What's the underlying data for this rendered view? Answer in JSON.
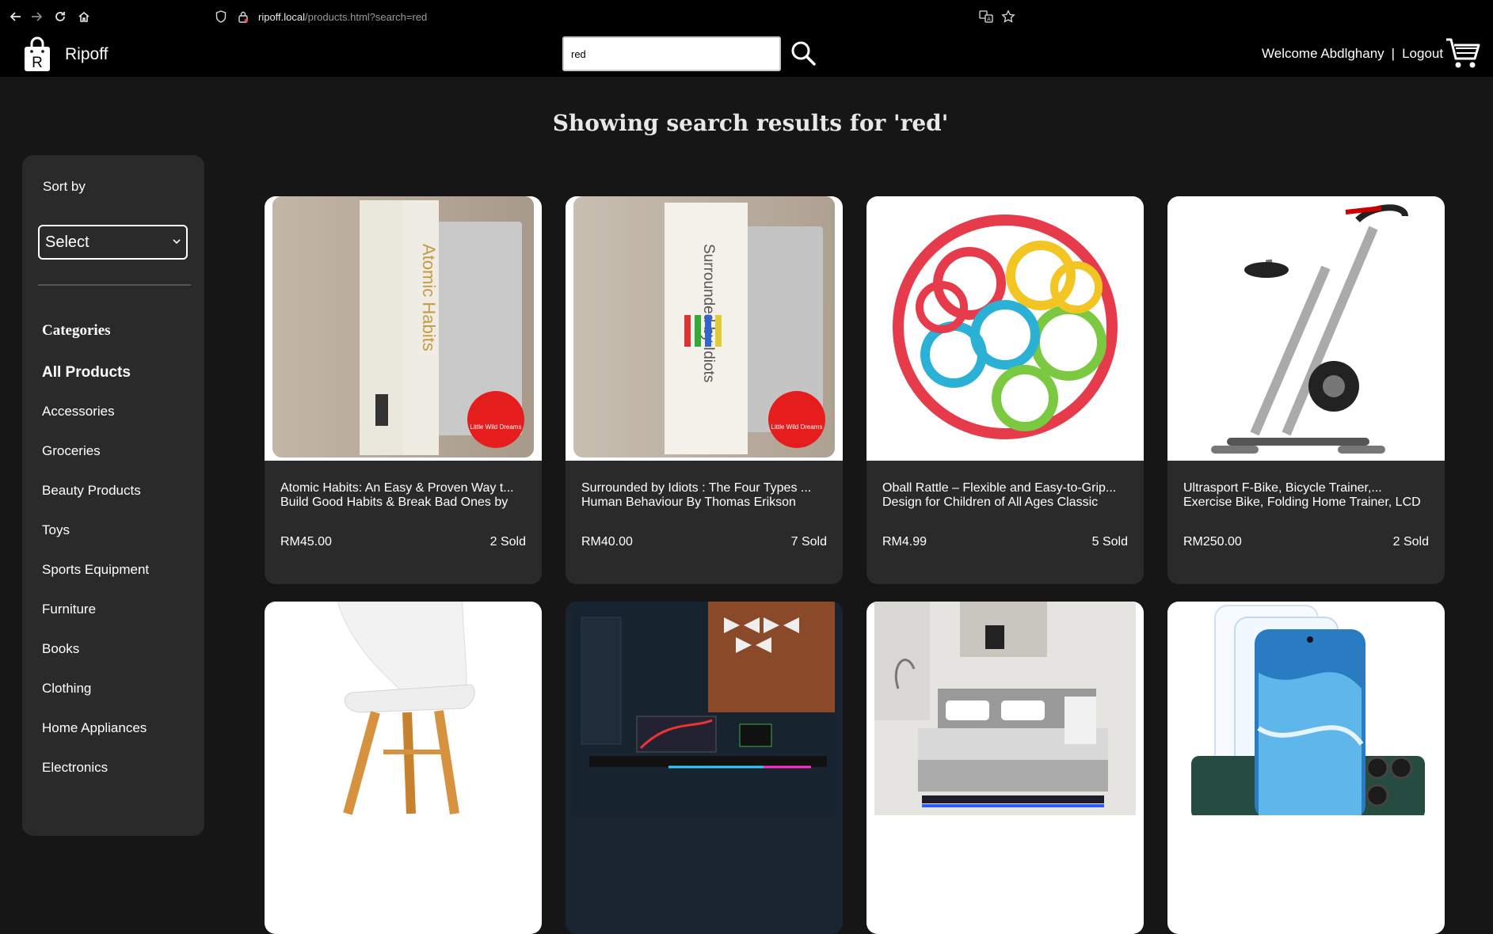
{
  "browser": {
    "url_host": "ripoff.local",
    "url_path": "/products.html?search=red"
  },
  "header": {
    "brand": "Ripoff",
    "logo_letter": "R",
    "search_value": "red",
    "welcome": "Welcome Abdlghany",
    "separator": "|",
    "logout": "Logout"
  },
  "page": {
    "title": "Showing search results for 'red'"
  },
  "sidebar": {
    "sort_label": "Sort by",
    "sort_value": "Select",
    "categories_heading": "Categories",
    "categories": [
      "All Products",
      "Accessories",
      "Groceries",
      "Beauty Products",
      "Toys",
      "Sports Equipment",
      "Furniture",
      "Books",
      "Clothing",
      "Home Appliances",
      "Electronics"
    ]
  },
  "products": [
    {
      "name": "Atomic Habits: An Easy & Proven Way t... Build Good Habits & Break Bad Ones by",
      "price": "RM45.00",
      "sold": "2 Sold",
      "image_icon": "book-atomic-habits-image",
      "image_text": "Atomic Habits",
      "badge_text": "Little Wild Dreams"
    },
    {
      "name": "Surrounded by Idiots : The Four Types ... Human Behaviour By Thomas Erikson",
      "price": "RM40.00",
      "sold": "7 Sold",
      "image_icon": "book-surrounded-by-idiots-image",
      "image_text": "Surrounded by Idiots",
      "badge_text": "Little Wild Dreams"
    },
    {
      "name": "Oball Rattle – Flexible and Easy-to-Grip... Design for Children of All Ages Classic",
      "price": "RM4.99",
      "sold": "5 Sold",
      "image_icon": "oball-rattle-image"
    },
    {
      "name": "Ultrasport F-Bike, Bicycle Trainer,... Exercise Bike, Folding Home Trainer, LCD",
      "price": "RM250.00",
      "sold": "2 Sold",
      "image_icon": "exercise-bike-image"
    },
    {
      "image_icon": "white-chair-image"
    },
    {
      "image_icon": "gaming-desk-setup-image"
    },
    {
      "image_icon": "led-bed-image"
    },
    {
      "image_icon": "phone-screen-protector-image"
    }
  ]
}
